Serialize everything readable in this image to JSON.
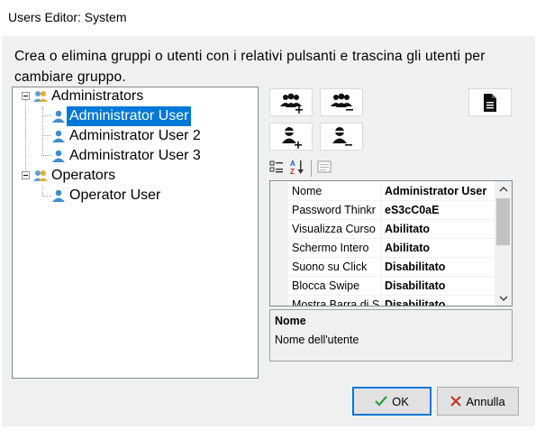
{
  "window": {
    "title": "Users Editor: System"
  },
  "description": "Crea o elimina gruppi o utenti con i relativi pulsanti e trascina gli utenti per cambiare gruppo.",
  "tree": {
    "groups": [
      {
        "label": "Administrators",
        "users": [
          "Administrator User",
          "Administrator User 2",
          "Administrator User 3"
        ]
      },
      {
        "label": "Operators",
        "users": [
          "Operator User"
        ]
      }
    ],
    "selected_user": "Administrator User"
  },
  "toolbar": {
    "add_group_icon": "add-group-icon",
    "remove_group_icon": "remove-group-icon",
    "add_user_icon": "add-user-icon",
    "remove_user_icon": "remove-user-icon",
    "document_icon": "document-icon"
  },
  "property_grid": {
    "toolbar_icons": [
      "categorized-icon",
      "alphabetical-icon",
      "property-pages-icon"
    ],
    "rows": [
      {
        "name": "Nome",
        "value": "Administrator User"
      },
      {
        "name": "Password Thinkr",
        "value": "eS3cC0aE"
      },
      {
        "name": "Visualizza Curso",
        "value": "Abilitato"
      },
      {
        "name": "Schermo Intero",
        "value": "Abilitato"
      },
      {
        "name": "Suono su Click",
        "value": "Disabilitato"
      },
      {
        "name": "Blocca Swipe",
        "value": "Disabilitato"
      },
      {
        "name": "Mostra Barra di S",
        "value": "Disabilitato"
      }
    ]
  },
  "help": {
    "title": "Nome",
    "description": "Nome dell'utente"
  },
  "buttons": {
    "ok": "OK",
    "cancel": "Annulla"
  },
  "colors": {
    "selection": "#0078d7",
    "ok_icon": "#2e9e3e",
    "cancel_icon": "#c0392b"
  }
}
